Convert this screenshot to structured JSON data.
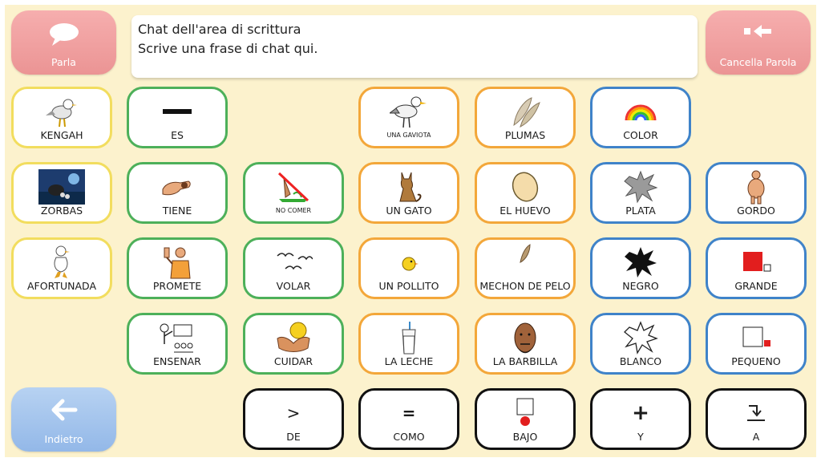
{
  "actions": {
    "speak": "Parla",
    "delete_word": "Cancella Parola",
    "back": "Indietro"
  },
  "chat": {
    "line1": "Chat dell'area di scrittura",
    "line2": "Scrive una frase di chat qui."
  },
  "colors": {
    "background": "#fcf2cd",
    "yellow": "#f2dd5e",
    "green": "#4db05a",
    "orange": "#f3a73a",
    "blue": "#3f83c9",
    "black": "#111111",
    "action_red": "#eb9494",
    "action_blue": "#93b8e8"
  },
  "cells": [
    {
      "label": "KENGAH",
      "icon": "seagull-icon"
    },
    {
      "label": "ES",
      "icon": "dash-icon"
    },
    {
      "label": "UNA GAVIOTA",
      "icon": "seagull-icon"
    },
    {
      "label": "PLUMAS",
      "icon": "feathers-icon"
    },
    {
      "label": "COLOR",
      "icon": "rainbow-icon"
    },
    {
      "label": "ZORBAS",
      "icon": "movie-still-icon"
    },
    {
      "label": "TIENE",
      "icon": "hand-holding-icon"
    },
    {
      "label": "NO COMER",
      "icon": "no-eating-icon"
    },
    {
      "label": "UN GATO",
      "icon": "cat-icon"
    },
    {
      "label": "EL HUEVO",
      "icon": "egg-icon"
    },
    {
      "label": "PLATA",
      "icon": "silver-splash-icon"
    },
    {
      "label": "GORDO",
      "icon": "fat-person-icon"
    },
    {
      "label": "AFORTUNADA",
      "icon": "lucky-seagull-icon"
    },
    {
      "label": "PROMETE",
      "icon": "promise-person-icon"
    },
    {
      "label": "VOLAR",
      "icon": "flying-birds-icon"
    },
    {
      "label": "UN POLLITO",
      "icon": "chick-icon"
    },
    {
      "label": "MECHON DE PELO",
      "icon": "tuft-icon"
    },
    {
      "label": "NEGRO",
      "icon": "black-splash-icon"
    },
    {
      "label": "GRANDE",
      "icon": "big-square-icon"
    },
    {
      "label": "ENSENAR",
      "icon": "teacher-icon"
    },
    {
      "label": "CUIDAR",
      "icon": "caring-hands-icon"
    },
    {
      "label": "LA LECHE",
      "icon": "milk-glass-icon"
    },
    {
      "label": "LA BARBILLA",
      "icon": "chin-face-icon"
    },
    {
      "label": "BLANCO",
      "icon": "white-splash-icon"
    },
    {
      "label": "PEQUENO",
      "icon": "small-square-icon"
    },
    {
      "label": "DE",
      "icon": "greater-than-icon",
      "glyph": ">"
    },
    {
      "label": "COMO",
      "icon": "equals-icon",
      "glyph": "="
    },
    {
      "label": "BAJO",
      "icon": "under-icon"
    },
    {
      "label": "Y",
      "icon": "plus-icon",
      "glyph": "+"
    },
    {
      "label": "A",
      "icon": "to-arrow-icon"
    }
  ]
}
